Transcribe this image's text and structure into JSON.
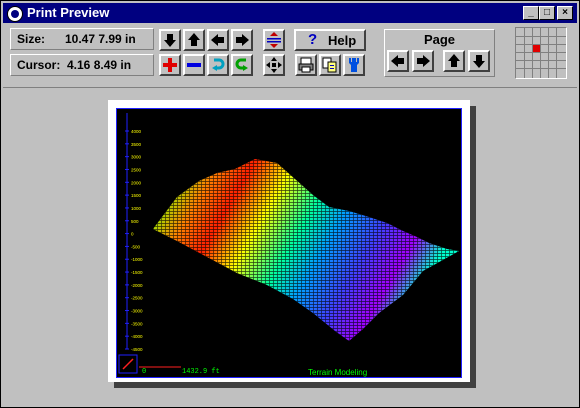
{
  "window": {
    "title": "Print Preview"
  },
  "toolbar": {
    "size_label": "Size:",
    "size_value": "10.47  7.99 in",
    "cursor_label": "Cursor:",
    "cursor_value": "4.16 8.49 in",
    "help_label": "Help",
    "page_label": "Page"
  },
  "plot": {
    "y_ticks": [
      "4000",
      "3500",
      "3000",
      "2500",
      "2000",
      "1500",
      "1000",
      "500",
      "0",
      "-500",
      "-1000",
      "-1500",
      "-2000",
      "-2500",
      "-3000",
      "-3500",
      "-4000",
      "-4500"
    ],
    "scale_start": "0",
    "scale_end": "1432.9 ft",
    "footer_title": "Terrain Modeling"
  }
}
